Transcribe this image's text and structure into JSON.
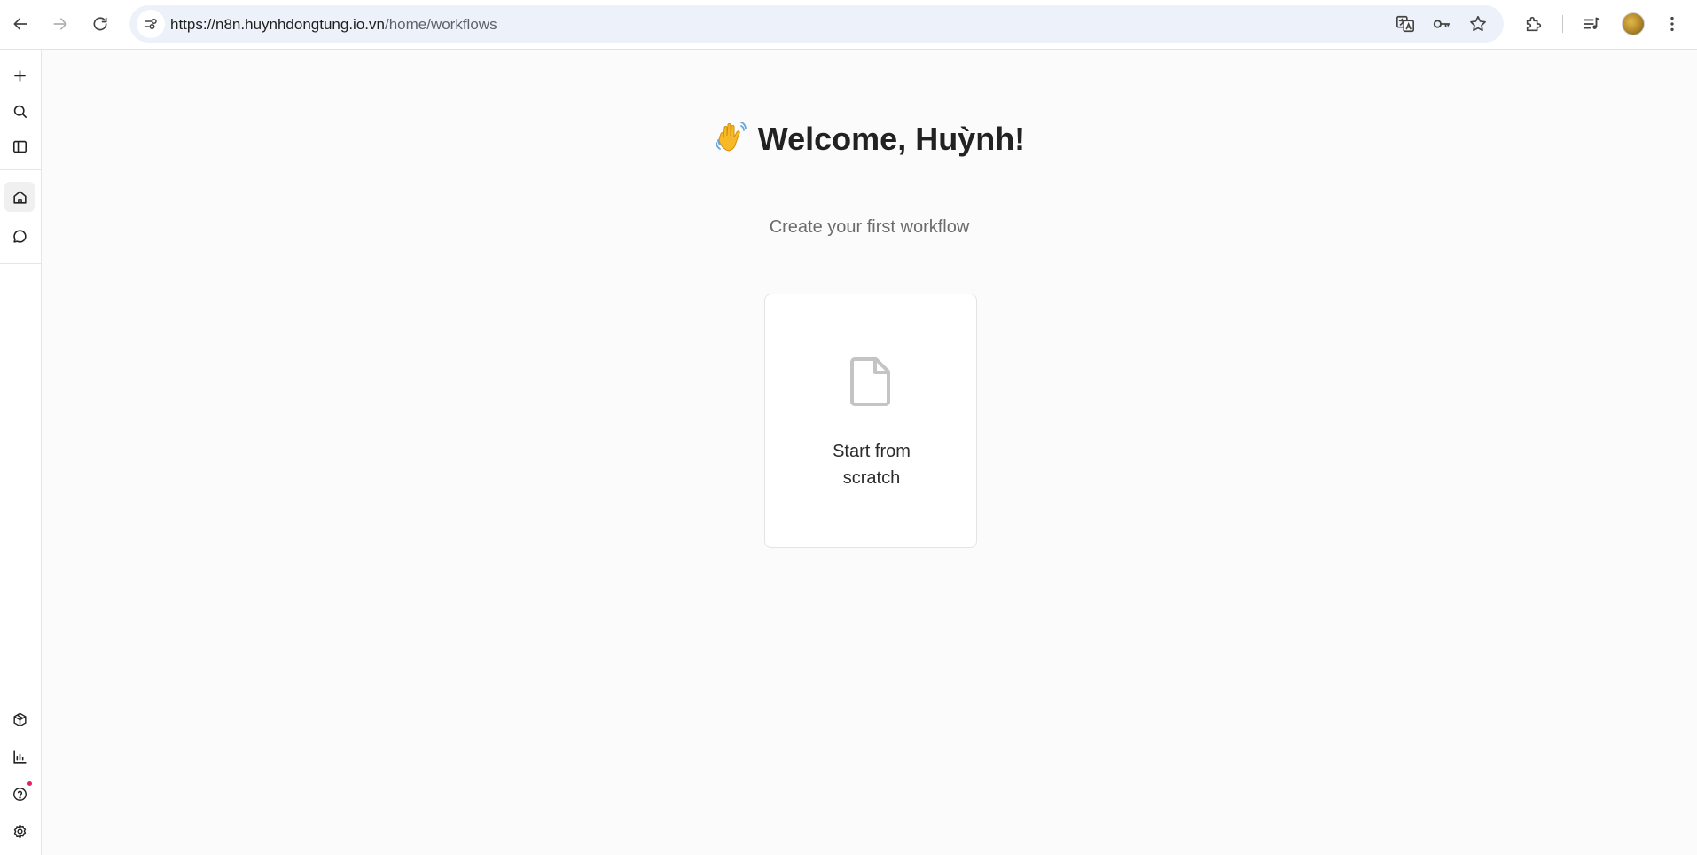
{
  "browser": {
    "url_host": "https://n8n.huynhdongtung.io.vn",
    "url_path": "/home/workflows",
    "toolbar_icons": [
      "back-icon",
      "forward-icon",
      "reload-icon",
      "site-info-icon",
      "translate-icon",
      "password-key-icon",
      "bookmark-star-icon",
      "extensions-icon",
      "media-controls-icon",
      "profile-avatar",
      "more-menu-icon"
    ]
  },
  "sidebar": {
    "top_items": [
      "add-icon",
      "search-icon",
      "toggle-sidebar-icon"
    ],
    "nav_items": [
      "home-icon",
      "chat-icon"
    ],
    "bottom_items": [
      "templates-icon",
      "insights-icon",
      "help-icon",
      "settings-icon"
    ],
    "active": "home-icon",
    "help_has_notification": true
  },
  "main": {
    "welcome_text": "Welcome, Huỳnh!",
    "subtitle": "Create your first workflow",
    "start_card": {
      "line1": "Start from",
      "line2": "scratch"
    }
  },
  "colors": {
    "background": "#fbfbfb",
    "omnibox": "#edf2fa",
    "notification_dot": "#e0245e"
  }
}
